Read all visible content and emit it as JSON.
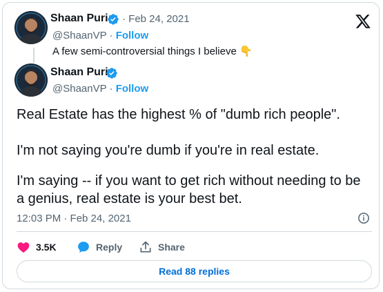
{
  "quoted": {
    "name": "Shaan Puri",
    "handle": "@ShaanVP",
    "date": "Feb 24, 2021",
    "follow": "Follow",
    "text": "A few semi-controversial things I believe",
    "emoji": "👇"
  },
  "tweet": {
    "name": "Shaan Puri",
    "handle": "@ShaanVP",
    "follow": "Follow",
    "lines": [
      "Real Estate has the highest % of \"dumb rich people\".",
      "I'm not saying you're dumb if you're in real estate.",
      "I'm saying -- if you want to get rich without needing to be",
      "a genius, real estate is your best bet."
    ],
    "timestamp": "12:03 PM · Feb 24, 2021"
  },
  "actions": {
    "likes": "3.5K",
    "reply": "Reply",
    "share": "Share"
  },
  "read_replies": "Read 88 replies",
  "colors": {
    "link": "#1d9bf0",
    "like": "#f91880",
    "text": "#0f1419",
    "muted": "#536471",
    "border": "#cfd9de"
  },
  "icons": [
    "x-logo-icon",
    "verified-badge-icon",
    "heart-icon",
    "reply-icon",
    "share-icon",
    "info-icon"
  ]
}
